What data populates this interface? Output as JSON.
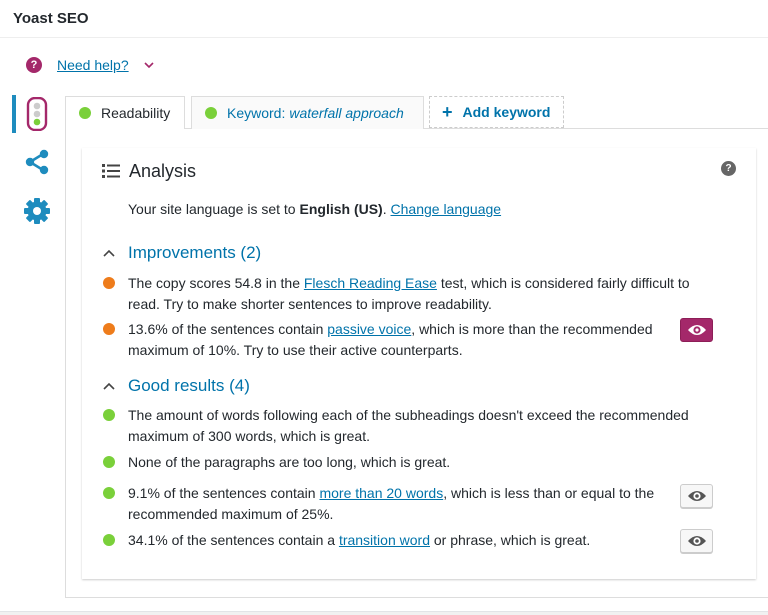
{
  "panel": {
    "title": "Yoast SEO"
  },
  "help": {
    "label": "Need help?",
    "icon": "question-icon"
  },
  "side_tabs": [
    {
      "name": "readability-tab",
      "icon": "traffic-light-icon",
      "active": true
    },
    {
      "name": "social-tab",
      "icon": "share-icon",
      "active": false
    },
    {
      "name": "settings-tab",
      "icon": "gear-icon",
      "active": false
    }
  ],
  "tabs": {
    "readability": "Readability",
    "keyword_prefix": "Keyword:",
    "keyword_value": "waterfall approach",
    "add_keyword": "Add keyword"
  },
  "analysis": {
    "heading": "Analysis",
    "language": {
      "prefix": "Your site language is set to ",
      "value": "English (US)",
      "suffix": ". ",
      "link": "Change language"
    },
    "improvements": {
      "heading": "Improvements (2)",
      "items": [
        {
          "status": "orange",
          "pre": "The copy scores 54.8 in the ",
          "link": "Flesch Reading Ease",
          "post": " test, which is considered fairly difficult to read. Try to make shorter sentences to improve readability.",
          "eye": null
        },
        {
          "status": "orange",
          "pre": "13.6% of the sentences contain ",
          "link": "passive voice",
          "post": ", which is more than the recommended maximum of 10%. Try to use their active counterparts.",
          "eye": "active"
        }
      ]
    },
    "good": {
      "heading": "Good results (4)",
      "items": [
        {
          "status": "green",
          "pre": "The amount of words following each of the subheadings doesn't exceed the recommended maximum of 300 words, which is great.",
          "link": "",
          "post": "",
          "eye": null
        },
        {
          "status": "green",
          "pre": "None of the paragraphs are too long, which is great.",
          "link": "",
          "post": "",
          "eye": null
        },
        {
          "status": "green",
          "pre": "9.1% of the sentences contain ",
          "link": "more than 20 words",
          "post": ", which is less than or equal to the recommended maximum of 25%.",
          "eye": "idle"
        },
        {
          "status": "green",
          "pre": "34.1% of the sentences contain a ",
          "link": "transition word",
          "post": " or phrase, which is great.",
          "eye": "idle"
        }
      ]
    }
  },
  "colors": {
    "accent": "#a4286a",
    "link": "#0073aa",
    "good": "#7ad03a",
    "warn": "#ee7c1b"
  }
}
